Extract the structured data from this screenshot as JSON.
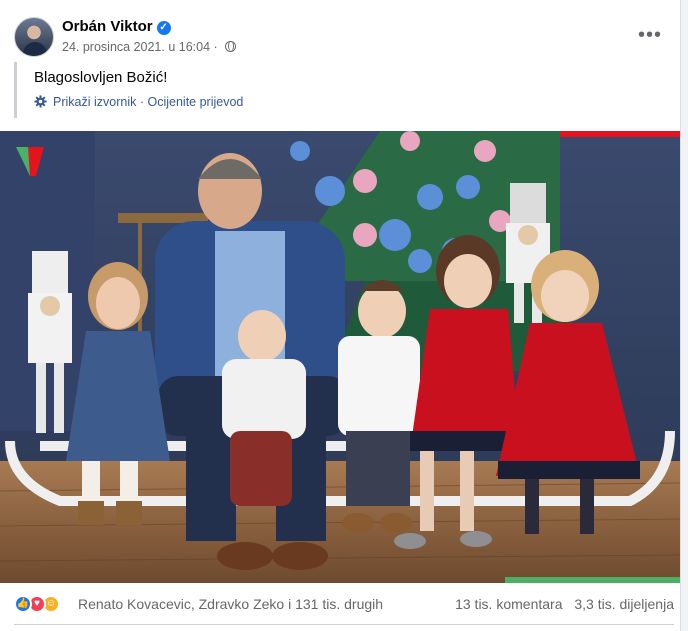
{
  "post": {
    "author": "Orbán Viktor",
    "timestamp": "24. prosinca 2021. u 16:04",
    "audience_icon": "globe-icon",
    "text": "Blagoslovljen Božić!",
    "see_original": "Prikaži izvornik",
    "rate_translation": "Ocijenite prijevod",
    "separator": "·"
  },
  "reactions": {
    "icons": [
      "like-icon",
      "love-icon",
      "care-icon"
    ],
    "names": "Renato Kovacevic, Zdravko Zeko i 131 tis. drugih",
    "comments": "13 tis. komentara",
    "shares": "3,3 tis. dijeljenja"
  },
  "colors": {
    "link": "#385898",
    "verified": "#1877f2",
    "secondary_text": "#65676b",
    "dress_red": "#c8101e",
    "brand_red": "#e3141c",
    "brand_green": "#4caf68"
  }
}
